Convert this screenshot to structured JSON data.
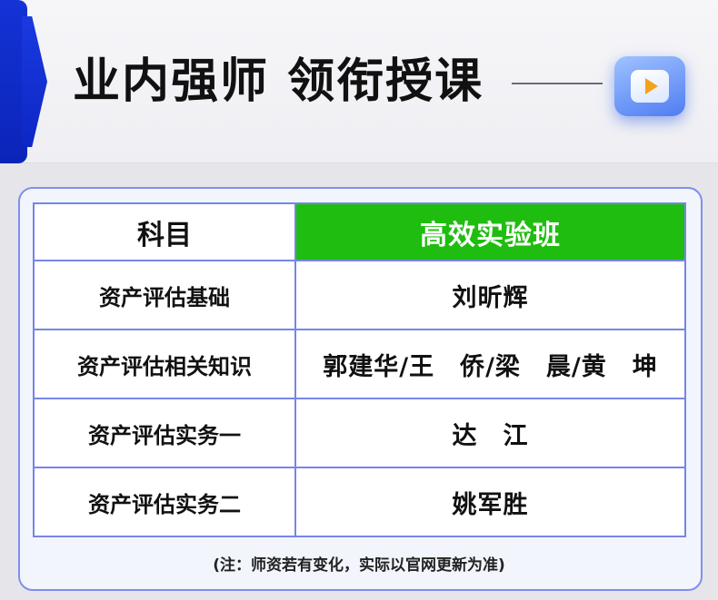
{
  "header": {
    "title": "业内强师 领衔授课",
    "play_icon": "play-icon",
    "accent_color": "#1433d6"
  },
  "table": {
    "columns": [
      "科目",
      "高效实验班"
    ],
    "header_highlight_color": "#1fbd10",
    "rows": [
      {
        "subject": "资产评估基础",
        "teacher": "刘昕辉"
      },
      {
        "subject": "资产评估相关知识",
        "teacher": "郭建华/王　侨/梁　晨/黄　坤"
      },
      {
        "subject": "资产评估实务一",
        "teacher": "达　江"
      },
      {
        "subject": "资产评估实务二",
        "teacher": "姚军胜"
      }
    ]
  },
  "note": "(注：师资若有变化，实际以官网更新为准)"
}
